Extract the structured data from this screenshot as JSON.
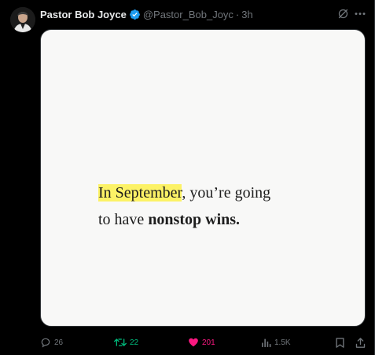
{
  "tweet": {
    "author_name": "Pastor Bob Joyce",
    "handle": "@Pastor_Bob_Joyc",
    "separator": "·",
    "time": "3h",
    "verified": true
  },
  "media": {
    "text_before_highlight": "",
    "highlight": "In September",
    "line1_rest": ", you’re going",
    "line2_normal": "to have ",
    "line2_bold": "nonstop wins."
  },
  "actions": {
    "replies": "26",
    "reposts": "22",
    "likes": "201",
    "views": "1.5K"
  },
  "colors": {
    "background": "#000000",
    "text_primary": "#e7e9ea",
    "text_secondary": "#71767b",
    "verified_blue": "#1d9bf0",
    "repost_green": "#00ba7c",
    "like_pink": "#f91880",
    "highlight_yellow": "#fcf266",
    "card_background": "#f8f8f7"
  },
  "icons": {
    "verified": "verified-badge-icon",
    "grok": "grok-icon",
    "more": "more-options-icon",
    "reply": "reply-icon",
    "repost": "repost-icon",
    "like": "heart-icon",
    "views": "views-chart-icon",
    "bookmark": "bookmark-icon",
    "share": "share-icon"
  }
}
